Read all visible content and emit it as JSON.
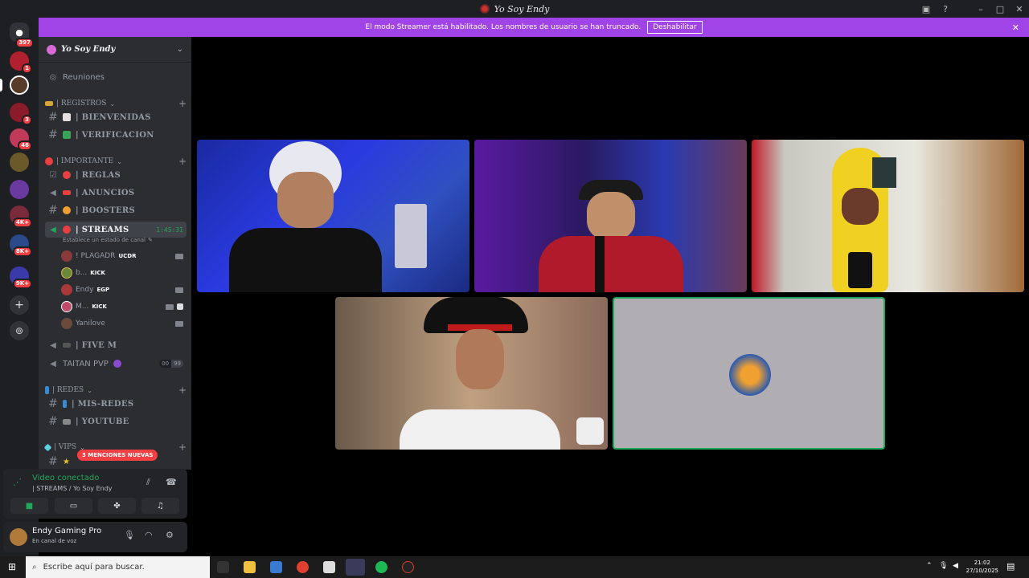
{
  "window": {
    "title": "Yo Soy Endy"
  },
  "server_rail": {
    "home_badge": "397",
    "servers": [
      {
        "badge": "1",
        "color": "#b0202f"
      },
      {
        "badge": "",
        "color": "#5a3b2a"
      },
      {
        "badge": "3",
        "color": "#8b1a2a"
      },
      {
        "badge": "46",
        "color": "#c23a5a"
      },
      {
        "badge": "",
        "color": "#6a5a2a"
      },
      {
        "badge": "",
        "color": "#6a3aa0"
      },
      {
        "badge": "4K+",
        "color": "#7a2a3a"
      },
      {
        "badge": "8K+",
        "color": "#2a4a8a"
      },
      {
        "badge": "9K+",
        "color": "#3a3aaa"
      }
    ],
    "add_label": "+",
    "explore_label": "⊚"
  },
  "banner": {
    "message": "El modo Streamer está habilitado. Los nombres de usuario se han truncado.",
    "button": "Deshabilitar",
    "close": "✕"
  },
  "sidebar": {
    "guild_name": "Yo Soy Endy",
    "reuniones": "Reuniones",
    "cat_registros": "| REGISTROS",
    "ch_bienvenidas": "| BIENVENIDAS",
    "ch_verificacion": "| VERIFICACION",
    "cat_importante": "| IMPORTANTE",
    "ch_reglas": "| REGLAS",
    "ch_anuncios": "| ANUNCIOS",
    "ch_boosters": "| BOOSTERS",
    "ch_streams": "| STREAMS",
    "streams_time": "1:45:31",
    "streams_status": "Establece un estado de canal",
    "voice_users": [
      {
        "name": "! PLAGADR",
        "tag": "UCDR",
        "color": "#8a3a3a"
      },
      {
        "name": "b...",
        "tag": "KICK",
        "color": "#6a8a3a"
      },
      {
        "name": "Endy",
        "tag": "EGP",
        "color": "#aa3a3a"
      },
      {
        "name": "M...",
        "tag": "KICK",
        "color": "#c04a6a"
      },
      {
        "name": "Yanilove",
        "tag": "",
        "color": "#6a4a3a"
      }
    ],
    "ch_fivem": "| FIVE M",
    "ch_taitan": "TAITAN PVP",
    "taitan_count_a": "00",
    "taitan_count_b": "99",
    "cat_redes": "| REDES",
    "ch_misredes": "| MIS-REDES",
    "ch_youtube": "| YOUTUBE",
    "cat_vips": "| VIPS",
    "mentions": "3 MENCIONES NUEVAS"
  },
  "voice_panel": {
    "status": "Video conectado",
    "channel": "| STREAMS / Yo Soy Endy"
  },
  "user_panel": {
    "name": "Endy Gaming Pro",
    "sub": "En canal de voz"
  },
  "taskbar": {
    "search_placeholder": "Escribe aquí para buscar.",
    "time": "21:02",
    "date": "27/10/2025"
  },
  "colors": {
    "accent": "#a044e8",
    "connected": "#23a55a",
    "danger": "#f23f43"
  }
}
